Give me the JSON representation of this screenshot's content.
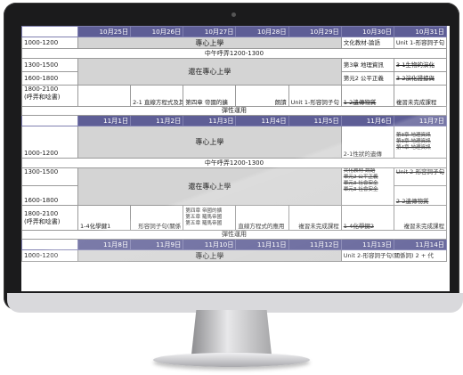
{
  "week1": {
    "dates": [
      "10月25日",
      "10月26日",
      "10月27日",
      "10月28日",
      "10月29日",
      "10月30日",
      "10月31日"
    ],
    "slot_1000": "1000-1200",
    "study_block": "專心上學",
    "lunch": "中午呼弄1200-1300",
    "slot_1300": "1300-1500",
    "slot_1600": "1600-1800",
    "still_study": "還在專心上學",
    "slot_1800": "1800-2100",
    "slot_1800_note": "(呼弄和唸書)",
    "flex": "彈性運用",
    "oct30_1000": "文化教材-論語",
    "oct31_1000": "Unit 1-形容詞子句",
    "oct30_1300": "第3章 地理資訊",
    "oct31_1300": "3-1生物的演化",
    "oct30_1600": "第元2 公平正義",
    "oct31_1600": "3-2演化證據與",
    "oct26_1800": "2-1 直線方程式及其圖形",
    "oct27_1800": "第四章 帝國的擴",
    "oct28_1800": "朗讀",
    "oct29_1800": "Unit 1-形容詞子句",
    "oct30_1800": "1-2遺傳物質",
    "oct31_1800": "複習未完成課程"
  },
  "week2": {
    "dates": [
      "11月1日",
      "11月2日",
      "11月3日",
      "11月4日",
      "11月5日",
      "11月6日",
      "11月7日"
    ],
    "slot_1000": "1000-1200",
    "study_block": "專心上學",
    "lunch": "中午呼弄1200-1300",
    "slot_1300": "1300-1500",
    "slot_1600": "1600-1800",
    "still_study": "還在專心上學",
    "slot_1800": "1800-2100",
    "slot_1800_note": "(呼弄和唸書)",
    "flex": "彈性運用",
    "nov6_1000": "2-1性狀的遺傳",
    "nov7_1000_a": "第3章 地理資訊",
    "nov7_1000_b": "第3章 地理資訊",
    "nov7_1000_c": "第4章 地理資訊",
    "nov6_1300_a": "文化教材-論語",
    "nov7_1300": "Unit 2-形容詞子句",
    "nov6_1300_b": "單元2 公平正義",
    "nov6_1300_c": "單元3 社會安全",
    "nov6_1300_d": "單元3 社會安全",
    "nov7_1600": "2-2遺傳物質",
    "nov1_1800": "1-4化學鍵1",
    "nov2_1800": "形容詞子句(關係",
    "nov3_1800_a": "第四章 帝國的擴",
    "nov3_1800_b": "第五章 羅馬帝國",
    "nov3_1800_c": "第五章 羅馬帝國",
    "nov4_1800": "直線方程式的應用",
    "nov5_1800": "複習未完成課程",
    "nov6_1800": "1-4化學鍵2",
    "nov7_1800": "複習未完成課程"
  },
  "week3": {
    "dates": [
      "11月8日",
      "11月9日",
      "11月10日",
      "11月11日",
      "11月12日",
      "11月13日",
      "11月14日"
    ],
    "slot_1000": "1000-1200",
    "study_block": "專心上學",
    "nov13_1000": "Unit 2-形容詞子句(關係詞) 2 + 代"
  }
}
